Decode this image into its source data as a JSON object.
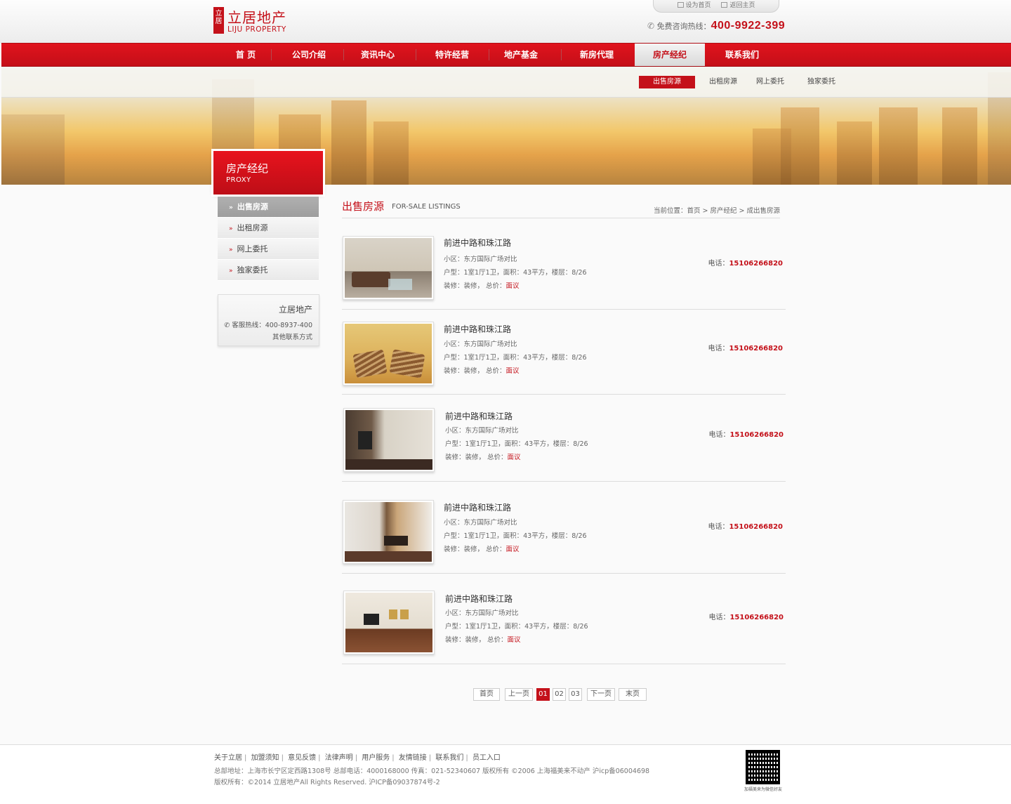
{
  "logo": {
    "mark": "立居",
    "name_cn": "立居地产",
    "name_en": "LIJU PROPERTY"
  },
  "topbar": {
    "set_home": "设为首页",
    "back_home": "返回主页"
  },
  "hotline": {
    "label": "免费咨询热线：",
    "number": "400-9922-399"
  },
  "nav": [
    {
      "label": "首 页"
    },
    {
      "label": "公司介绍"
    },
    {
      "label": "资讯中心"
    },
    {
      "label": "特许经营"
    },
    {
      "label": "地产基金"
    },
    {
      "label": "新房代理"
    },
    {
      "label": "房产经纪",
      "active": true
    },
    {
      "label": "联系我们"
    }
  ],
  "subnav": [
    {
      "label": "出售房源",
      "active": true
    },
    {
      "label": "出租房源"
    },
    {
      "label": "网上委托"
    },
    {
      "label": "独家委托"
    }
  ],
  "sidebar": {
    "title_cn": "房产经纪",
    "title_en": "PROXY",
    "items": [
      {
        "label": "出售房源",
        "active": true
      },
      {
        "label": "出租房源"
      },
      {
        "label": "网上委托"
      },
      {
        "label": "独家委托"
      }
    ],
    "contact": {
      "name": "立居地产",
      "hotline": "客服热线：400-8937-400",
      "other": "其他联系方式"
    }
  },
  "content": {
    "title_cn": "出售房源",
    "title_en": "FOR-SALE LISTINGS",
    "breadcrumb": "当前位置：首页 > 房产经纪 > 成出售房源"
  },
  "listings": [
    {
      "title": "前进中路和珠江路",
      "community": "小区：东方国际广场对比",
      "layout": "户型：1室1厅1卫，面积：43平方，楼层：8/26",
      "decor": "装修：装修，  总价：",
      "price": "面议",
      "phone_label": "电话：",
      "phone": "15106266820"
    },
    {
      "title": "前进中路和珠江路",
      "community": "小区：东方国际广场对比",
      "layout": "户型：1室1厅1卫，面积：43平方，楼层：8/26",
      "decor": "装修：装修，  总价：",
      "price": "面议",
      "phone_label": "电话：",
      "phone": "15106266820"
    },
    {
      "title": "前进中路和珠江路",
      "community": "小区：东方国际广场对比",
      "layout": "户型：1室1厅1卫，面积：43平方，楼层：8/26",
      "decor": "装修：装修，  总价：",
      "price": "面议",
      "phone_label": "电话：",
      "phone": "15106266820"
    },
    {
      "title": "前进中路和珠江路",
      "community": "小区：东方国际广场对比",
      "layout": "户型：1室1厅1卫，面积：43平方，楼层：8/26",
      "decor": "装修：装修，  总价：",
      "price": "面议",
      "phone_label": "电话：",
      "phone": "15106266820"
    },
    {
      "title": "前进中路和珠江路",
      "community": "小区：东方国际广场对比",
      "layout": "户型：1室1厅1卫，面积：43平方，楼层：8/26",
      "decor": "装修：装修，  总价：",
      "price": "面议",
      "phone_label": "电话：",
      "phone": "15106266820"
    }
  ],
  "pagination": {
    "first": "首页",
    "prev": "上一页",
    "pages": [
      "01",
      "02",
      "03"
    ],
    "current": "01",
    "next": "下一页",
    "last": "末页"
  },
  "footer": {
    "links": [
      "关于立居",
      "加盟须知",
      "意见反馈",
      "法律声明",
      "用户服务",
      "友情链接",
      "联系我们",
      "员工入口"
    ],
    "address": "总部地址：上海市长宁区定西路1308号 总部电话：4000168000 传真：021-52340607 版权所有 ©2006 上海福美来不动产 沪icp备06004698",
    "copyright": "版权所有：©2014 立居地产All Rights Reserved.   沪ICP备09037874号-2",
    "qr_caption": "加福美来为微信好友"
  },
  "colors": {
    "brand_red": "#c4111a",
    "nav_red": "#d8121b"
  }
}
